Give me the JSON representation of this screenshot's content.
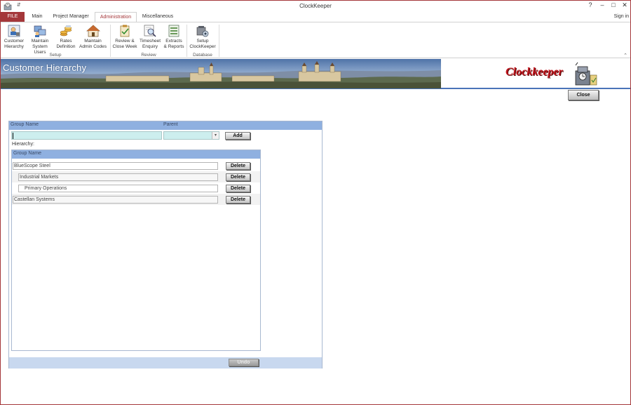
{
  "window": {
    "title": "ClockKeeper",
    "help": "?",
    "minimize": "–",
    "maximize": "□",
    "close": "✕",
    "qat_arrow": "⇵"
  },
  "tabs": {
    "file": "FILE",
    "main": "Main",
    "project_manager": "Project Manager",
    "administration": "Administration",
    "miscellaneous": "Miscellaneous",
    "sign_in": "Sign in"
  },
  "ribbon": {
    "customer_hierarchy": [
      "Customer",
      "Hierarchy"
    ],
    "maintain_system_users": [
      "Maintain",
      "System Users"
    ],
    "rates_definition": [
      "Rates",
      "Definition"
    ],
    "maintain_admin_codes": [
      "Maintain",
      "Admin Codes"
    ],
    "review_close_week": [
      "Review &",
      "Close Week"
    ],
    "timesheet_enquiry": [
      "Timesheet",
      "Enquiry"
    ],
    "extracts_reports": [
      "Extracts",
      "& Reports"
    ],
    "setup_clockkeeper": [
      "Setup",
      "ClockKeeper"
    ],
    "groups": {
      "setup": "Setup",
      "review": "Review",
      "database": "Database"
    },
    "collapse_glyph": "⌃"
  },
  "banner": {
    "title": "Customer Hierarchy",
    "logo": "Clockkeeper"
  },
  "close_button": "Close",
  "form": {
    "group_name_header": "Group Name",
    "parent_header": "Parent",
    "group_name_value": "",
    "parent_value": "",
    "add_button": "Add",
    "hierarchy_label": "Hierarchy:",
    "list_header": "Group Name",
    "rows": [
      {
        "name": "BlueScope Steel",
        "indent": 0,
        "delete": "Delete"
      },
      {
        "name": "Industrial Markets",
        "indent": 1,
        "delete": "Delete"
      },
      {
        "name": "Primary Operations",
        "indent": 2,
        "delete": "Delete"
      },
      {
        "name": "Castellan Systems",
        "indent": 0,
        "delete": "Delete"
      }
    ],
    "undo_button": "Undo"
  },
  "colors": {
    "accent": "#a4373a",
    "header_blue": "#8fb0e0",
    "input_cyan": "#cdeeee",
    "logo_red": "#c0141c"
  }
}
